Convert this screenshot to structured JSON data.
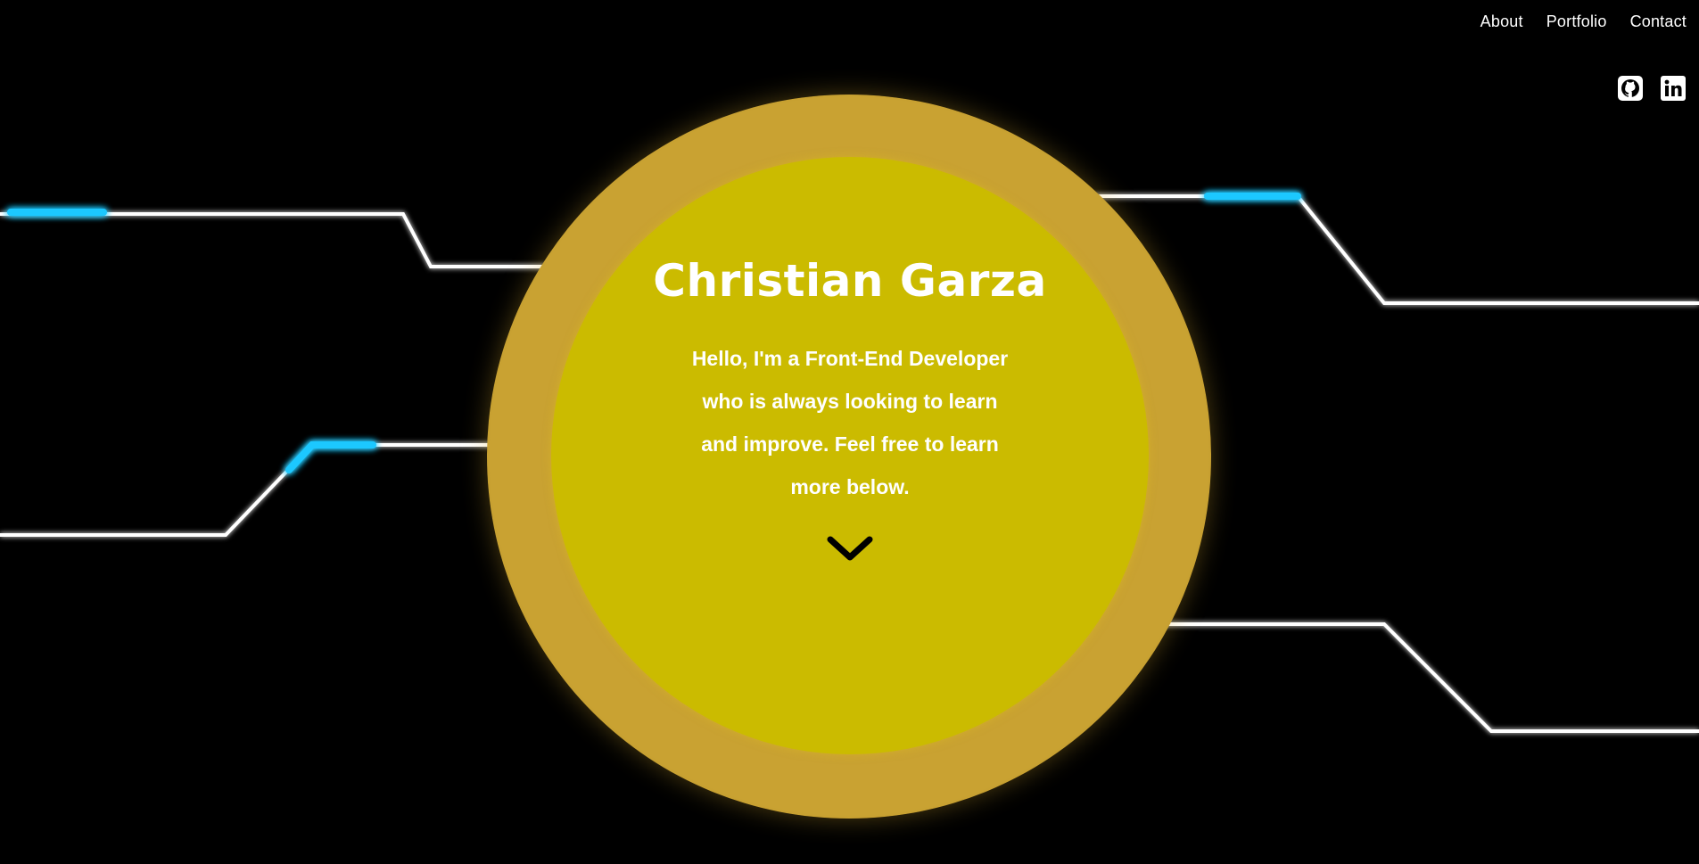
{
  "nav": {
    "items": [
      {
        "label": "About"
      },
      {
        "label": "Portfolio"
      },
      {
        "label": "Contact"
      }
    ]
  },
  "social": {
    "icons": [
      "github-icon",
      "linkedin-icon"
    ]
  },
  "hero": {
    "name": "Christian Garza",
    "intro": "Hello, I'm a Front-End Developer who is always looking to learn and improve. Feel free to learn more below.",
    "scroll_icon": "chevron-down-icon"
  },
  "colors": {
    "background": "#000000",
    "disc": "#cbbb00",
    "halo": "#c9a232",
    "trace": "#ffffff",
    "trace_highlight": "#1ec8ff",
    "text": "#ffffff",
    "chevron": "#000000"
  }
}
